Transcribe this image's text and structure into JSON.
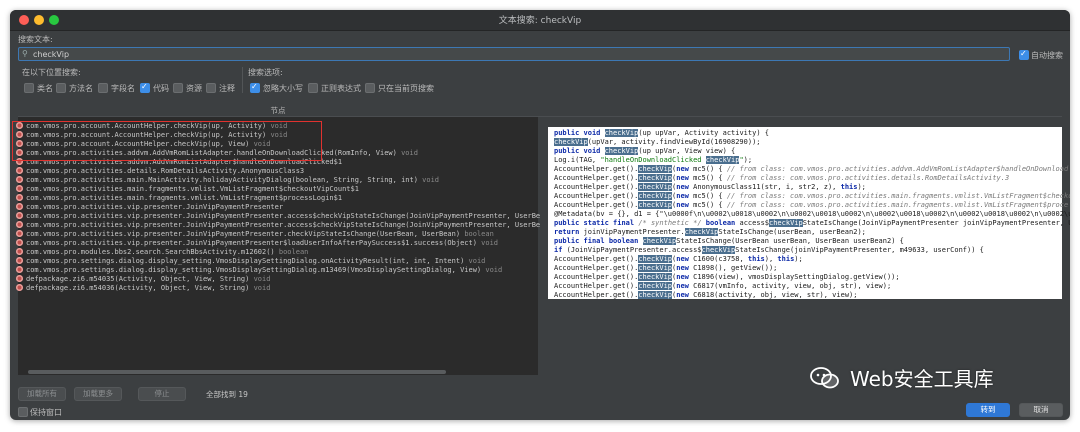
{
  "window": {
    "title": "文本搜索: checkVip"
  },
  "search": {
    "label": "搜索文本:",
    "value": "checkVip",
    "auto_search_label": "自动搜索",
    "auto_search_checked": true
  },
  "search_in": {
    "label": "在以下位置搜索:",
    "options": [
      {
        "label": "类名",
        "checked": false
      },
      {
        "label": "方法名",
        "checked": false
      },
      {
        "label": "字段名",
        "checked": false
      },
      {
        "label": "代码",
        "checked": true
      },
      {
        "label": "资源",
        "checked": false
      },
      {
        "label": "注释",
        "checked": false
      }
    ]
  },
  "search_options": {
    "label": "搜索选项:",
    "options": [
      {
        "label": "忽略大小写",
        "checked": true
      },
      {
        "label": "正则表达式",
        "checked": false
      },
      {
        "label": "只在当前页搜索",
        "checked": false
      }
    ]
  },
  "results": {
    "column_header": "节点",
    "rows": [
      {
        "sig": "com.vmos.pro.account.AccountHelper.checkVip(up, Activity)",
        "ret": "void"
      },
      {
        "sig": "com.vmos.pro.account.AccountHelper.checkVip(up, Activity)",
        "ret": "void"
      },
      {
        "sig": "com.vmos.pro.account.AccountHelper.checkVip(up, View)",
        "ret": "void"
      },
      {
        "sig": "com.vmos.pro.activities.addvm.AddVmRomListAdapter.handleOnDownloadClicked(RomInfo, View)",
        "ret": "void"
      },
      {
        "sig": "com.vmos.pro.activities.addvm.AddVmRomListAdapter$handleOnDownloadClicked$1",
        "ret": ""
      },
      {
        "sig": "com.vmos.pro.activities.details.RomDetailsActivity.AnonymousClass3",
        "ret": ""
      },
      {
        "sig": "com.vmos.pro.activities.main.MainActivity.holidayActivityDialog(boolean, String, String, int)",
        "ret": "void"
      },
      {
        "sig": "com.vmos.pro.activities.main.fragments.vmlist.VmListFragment$checkoutVipCount$1",
        "ret": ""
      },
      {
        "sig": "com.vmos.pro.activities.main.fragments.vmlist.VmListFragment$processLogin$1",
        "ret": ""
      },
      {
        "sig": "com.vmos.pro.activities.vip.presenter.JoinVipPaymentPresenter",
        "ret": ""
      },
      {
        "sig": "com.vmos.pro.activities.vip.presenter.JoinVipPaymentPresenter.access$checkVipStateIsChange(JoinVipPaymentPresenter, UserBe",
        "ret": ""
      },
      {
        "sig": "com.vmos.pro.activities.vip.presenter.JoinVipPaymentPresenter.access$checkVipStateIsChange(JoinVipPaymentPresenter, UserBe",
        "ret": ""
      },
      {
        "sig": "com.vmos.pro.activities.vip.presenter.JoinVipPaymentPresenter.checkVipStateIsChange(UserBean, UserBean)",
        "ret": "boolean"
      },
      {
        "sig": "com.vmos.pro.activities.vip.presenter.JoinVipPaymentPresenter$loadUserInfoAfterPaySuccess$1.success(Object)",
        "ret": "void"
      },
      {
        "sig": "com.vmos.pro.modules.bbs2.search.SearchBbsActivity.m12602()",
        "ret": "boolean"
      },
      {
        "sig": "com.vmos.pro.settings.dialog.display_setting.VmosDisplaySettingDialog.onActivityResult(int, int, Intent)",
        "ret": "void"
      },
      {
        "sig": "com.vmos.pro.settings.dialog.display_setting.VmosDisplaySettingDialog.m13469(VmosDisplaySettingDialog, View)",
        "ret": "void"
      },
      {
        "sig": "defpackage.zi6.m54035(Activity, Object, View, String)",
        "ret": "void"
      },
      {
        "sig": "defpackage.zi6.m54036(Activity, Object, View, String)",
        "ret": "void"
      }
    ]
  },
  "code_lines": [
    "public void checkVip(up upVar, Activity activity) {",
    "checkVip(upVar, activity.findViewById(16908290));",
    "public void checkVip(up upVar, View view) {",
    "Log.i(TAG, \"handleOnDownloadClicked checkVip\");",
    "AccountHelper.get().checkVip(new mc5() { // from class: com.vmos.pro.activities.addvm.AddVmRomListAdapter$handleOnDownload",
    "AccountHelper.get().checkVip(new mc5() { // from class: com.vmos.pro.activities.details.RomDetailsActivity.3",
    "AccountHelper.get().checkVip(new AnonymousClass11(str, i, str2, z), this);",
    "AccountHelper.get().checkVip(new mc5() { // from class: com.vmos.pro.activities.main.fragments.vmlist.VmListFragment$checko",
    "AccountHelper.get().checkVip(new mc5() { // from class: com.vmos.pro.activities.main.fragments.vmlist.VmListFragment$proce",
    "@Metadata(bv = {}, d1 = {\"\\u0000f\\n\\u0002\\u0018\\u0002\\n\\u0002\\u0018\\u0002\\n\\u0002\\u0018\\u0002\\n\\u0002\\u0018\\u0002\\n\\u0002\\u0018",
    "public static final /* synthetic */ boolean access$checkVipStateIsChange(JoinVipPaymentPresenter joinVipPaymentPresenter, U",
    "return joinVipPaymentPresenter.checkVipStateIsChange(userBean, userBean2);",
    "public final boolean checkVipStateIsChange(UserBean userBean, UserBean userBean2) {",
    "if (JoinVipPaymentPresenter.access$checkVipStateIsChange(joinVipPaymentPresenter, m49633, userConf)) {",
    "AccountHelper.get().checkVip(new C1600(c3758, this), this);",
    "AccountHelper.get().checkVip(new C1898(), getView());",
    "AccountHelper.get().checkVip(new C1896(view), vmosDisplaySettingDialog.getView());",
    "AccountHelper.get().checkVip(new C6817(vmInfo, activity, view, obj, str), view);",
    "AccountHelper.get().checkVip(new C6818(activity, obj, view, str), view);"
  ],
  "footer": {
    "load_all": "加载所有",
    "load_more": "加载更多",
    "stop": "停止",
    "found_text": "全部找到 19",
    "keep_open_label": "保持窗口",
    "keep_open_checked": false,
    "goto": "转到",
    "cancel": "取消"
  },
  "watermark": {
    "text": "Web安全工具库"
  }
}
